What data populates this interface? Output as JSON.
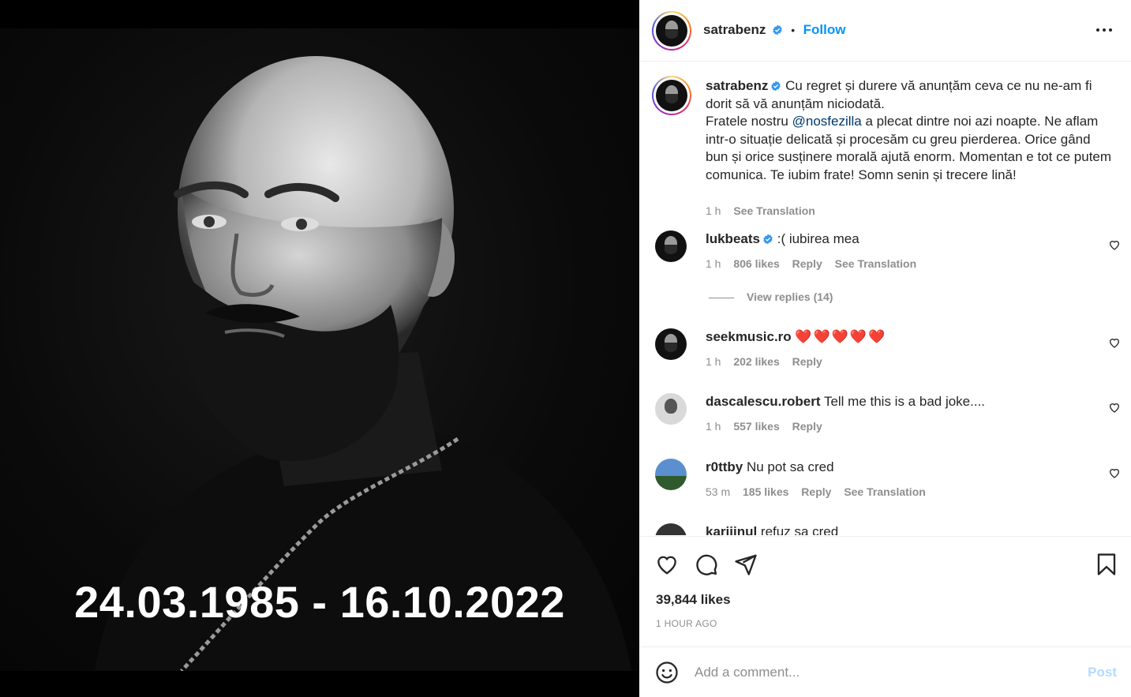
{
  "post": {
    "image_text": "24.03.1985 - 16.10.2022",
    "author": "satrabenz",
    "follow_label": "Follow",
    "separator": "•"
  },
  "caption": {
    "username": "satrabenz",
    "text_before_mention": "Cu regret și durere vă anunțăm ceva ce nu ne-am fi dorit să vă anunțăm niciodată.",
    "text_line2_start": "Fratele nostru ",
    "mention": "@nosfezilla",
    "text_after_mention": " a plecat dintre noi azi noapte. Ne aflam intr-o situație delicată și procesăm cu greu pierderea. Orice gând bun și orice susținere morală ajută enorm. Momentan e tot ce putem comunica. Te iubim frate! Somn senin și trecere lină!",
    "time": "1 h",
    "see_translation": "See Translation"
  },
  "comments": [
    {
      "username": "lukbeats",
      "verified": true,
      "text": ":( iubirea mea",
      "time": "1 h",
      "likes": "806 likes",
      "reply": "Reply",
      "see_translation": "See Translation"
    },
    {
      "username": "seekmusic.ro",
      "verified": false,
      "text": "❤️❤️❤️❤️❤️",
      "time": "1 h",
      "likes": "202 likes",
      "reply": "Reply",
      "see_translation": ""
    },
    {
      "username": "dascalescu.robert",
      "verified": false,
      "text": "Tell me this is a bad joke....",
      "time": "1 h",
      "likes": "557 likes",
      "reply": "Reply",
      "see_translation": ""
    },
    {
      "username": "r0ttby",
      "verified": false,
      "text": "Nu pot sa cred",
      "time": "53 m",
      "likes": "185 likes",
      "reply": "Reply",
      "see_translation": "See Translation"
    },
    {
      "username": "kariiinul",
      "verified": false,
      "text": "refuz sa cred",
      "time": "",
      "likes": "",
      "reply": "",
      "see_translation": ""
    }
  ],
  "view_replies": "View replies (14)",
  "footer": {
    "likes": "39,844 likes",
    "time_ago": "1 HOUR AGO",
    "comment_placeholder": "Add a comment...",
    "post_label": "Post"
  },
  "icons": {
    "more": "more-horizontal-icon",
    "like": "heart-icon",
    "comment": "comment-bubble-icon",
    "share": "paper-plane-icon",
    "save": "bookmark-icon",
    "emoji": "emoji-smile-icon",
    "verified": "verified-badge-icon"
  },
  "colors": {
    "link_blue": "#0095f6",
    "verified_blue": "#3897f0",
    "muted": "#8e8e8e",
    "post_disabled": "#b3dbff",
    "mention": "#00376b"
  }
}
